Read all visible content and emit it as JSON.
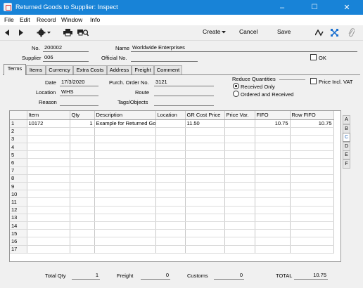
{
  "window": {
    "title": "Returned Goods to Supplier: Inspect",
    "minimize": "–",
    "maximize": "☐",
    "close": "✕"
  },
  "menu": [
    "File",
    "Edit",
    "Record",
    "Window",
    "Info"
  ],
  "toolbar": {
    "create": "Create",
    "cancel": "Cancel",
    "save": "Save"
  },
  "header": {
    "no_label": "No.",
    "no_value": "200002",
    "name_label": "Name",
    "name_value": "Worldwide Enterprises",
    "supplier_label": "Supplier",
    "supplier_value": "006",
    "official_label": "Official No.",
    "official_value": "",
    "ok_label": "OK"
  },
  "tabs": [
    "Terms",
    "Items",
    "Currency",
    "Extra Costs",
    "Address",
    "Freight",
    "Comment"
  ],
  "terms": {
    "date_label": "Date",
    "date_value": "17/3/2020",
    "location_label": "Location",
    "location_value": "WHS",
    "reason_label": "Reason",
    "reason_value": "",
    "purch_label": "Purch. Order No.",
    "purch_value": "3121",
    "route_label": "Route",
    "route_value": "",
    "tags_label": "Tags/Objects",
    "tags_value": "",
    "reduce_label": "Reduce Quantities",
    "radio_received": "Received Only",
    "radio_ordered": "Ordered and Received",
    "price_incl_label": "Price  Incl. VAT"
  },
  "grid": {
    "columns": [
      "Item",
      "Qty",
      "Description",
      "Location",
      "GR Cost Price",
      "Price Var.",
      "FIFO",
      "Row FIFO"
    ],
    "rows": [
      [
        "1",
        "10172",
        "1",
        "Example for Returned Go",
        "",
        "11.50",
        "",
        "10.75",
        "10.75"
      ],
      [
        "2",
        "",
        "",
        "",
        "",
        "",
        "",
        "",
        ""
      ],
      [
        "3",
        "",
        "",
        "",
        "",
        "",
        "",
        "",
        ""
      ],
      [
        "4",
        "",
        "",
        "",
        "",
        "",
        "",
        "",
        ""
      ],
      [
        "5",
        "",
        "",
        "",
        "",
        "",
        "",
        "",
        ""
      ],
      [
        "6",
        "",
        "",
        "",
        "",
        "",
        "",
        "",
        ""
      ],
      [
        "7",
        "",
        "",
        "",
        "",
        "",
        "",
        "",
        ""
      ],
      [
        "8",
        "",
        "",
        "",
        "",
        "",
        "",
        "",
        ""
      ],
      [
        "9",
        "",
        "",
        "",
        "",
        "",
        "",
        "",
        ""
      ],
      [
        "10",
        "",
        "",
        "",
        "",
        "",
        "",
        "",
        ""
      ],
      [
        "11",
        "",
        "",
        "",
        "",
        "",
        "",
        "",
        ""
      ],
      [
        "12",
        "",
        "",
        "",
        "",
        "",
        "",
        "",
        ""
      ],
      [
        "13",
        "",
        "",
        "",
        "",
        "",
        "",
        "",
        ""
      ],
      [
        "14",
        "",
        "",
        "",
        "",
        "",
        "",
        "",
        ""
      ],
      [
        "15",
        "",
        "",
        "",
        "",
        "",
        "",
        "",
        ""
      ],
      [
        "16",
        "",
        "",
        "",
        "",
        "",
        "",
        "",
        ""
      ],
      [
        "17",
        "",
        "",
        "",
        "",
        "",
        "",
        "",
        ""
      ]
    ],
    "side_tabs": [
      "A",
      "B",
      "C",
      "D",
      "E",
      "F"
    ],
    "active_side_tab": "C"
  },
  "footer": {
    "total_qty_label": "Total Qty",
    "total_qty_value": "1",
    "freight_label": "Freight",
    "freight_value": "0",
    "customs_label": "Customs",
    "customs_value": "0",
    "total_label": "TOTAL",
    "total_value": "10.75"
  },
  "colors": {
    "titlebar": "#1883d7",
    "accent": "#1a5fb4"
  }
}
